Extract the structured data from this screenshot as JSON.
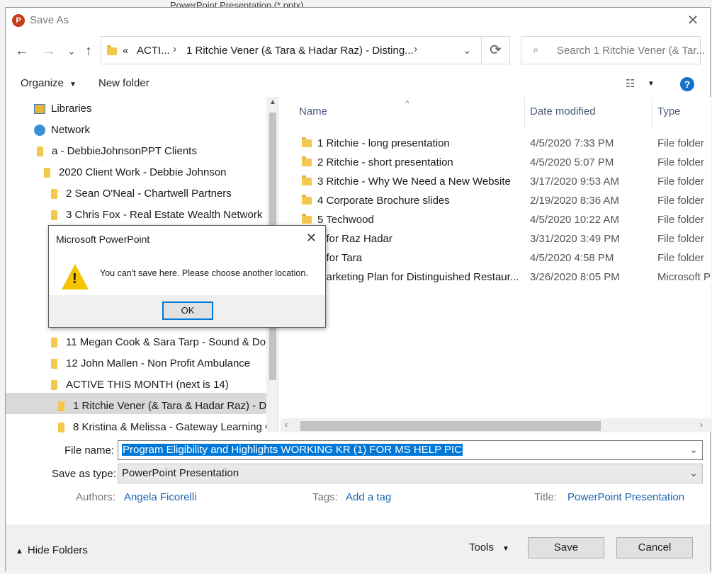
{
  "background": {
    "peek_title": "PowerPoint Presentation (*.pptx)"
  },
  "window": {
    "title": "Save As",
    "app_icon": "P",
    "close_icon": "✕"
  },
  "nav": {
    "back_icon": "←",
    "forward_icon": "→",
    "recent_icon": "⌄",
    "up_icon": "↑",
    "refresh_icon": "⟳",
    "breadcrumb": {
      "overflow": "«",
      "segments": [
        "ACTI...",
        "1 Ritchie Vener (& Tara & Hadar Raz) - Disting..."
      ],
      "separator": "›"
    },
    "dropdown_icon": "⌄",
    "search_placeholder": "Search 1 Ritchie Vener (& Tar..."
  },
  "toolbar": {
    "organize": "Organize",
    "new_folder": "New folder",
    "view_icon": "☷",
    "help": "?"
  },
  "navpane": {
    "items": [
      {
        "label": "Libraries",
        "icon": "libraries-icon",
        "indent": 0
      },
      {
        "label": "Network",
        "icon": "network-icon",
        "indent": 0
      },
      {
        "label": "a - DebbieJohnsonPPT Clients",
        "icon": "folder",
        "indent": 1
      },
      {
        "label": "2020 Client Work - Debbie Johnson",
        "icon": "folder",
        "indent": 2
      },
      {
        "label": "2 Sean O'Neal - Chartwell Partners",
        "icon": "folder",
        "indent": 3
      },
      {
        "label": "3 Chris Fox - Real Estate Wealth Network",
        "icon": "folder",
        "indent": 3
      },
      {
        "label": "11 Megan Cook & Sara Tarp - Sound & Do",
        "icon": "folder",
        "indent": 3
      },
      {
        "label": "12 John Mallen - Non Profit Ambulance",
        "icon": "folder",
        "indent": 3
      },
      {
        "label": "ACTIVE THIS MONTH (next is 14)",
        "icon": "folder",
        "indent": 3
      },
      {
        "label": "1 Ritchie Vener (& Tara & Hadar Raz) - Di",
        "icon": "folder",
        "indent": 4
      },
      {
        "label": "8 Kristina & Melissa - Gateway Learning G",
        "icon": "folder",
        "indent": 4
      }
    ]
  },
  "files": {
    "columns": {
      "name": "Name",
      "date": "Date modified",
      "type": "Type"
    },
    "rows": [
      {
        "name": "1 Ritchie - long presentation",
        "date": "4/5/2020 7:33 PM",
        "type": "File folder"
      },
      {
        "name": "2 Ritchie - short presentation",
        "date": "4/5/2020 5:07 PM",
        "type": "File folder"
      },
      {
        "name": "3 Ritchie - Why We Need a New Website",
        "date": "3/17/2020 9:53 AM",
        "type": "File folder"
      },
      {
        "name": "4 Corporate Brochure slides",
        "date": "2/19/2020 8:36 AM",
        "type": "File folder"
      },
      {
        "name": "5 Techwood",
        "date": "4/5/2020 10:22 AM",
        "type": "File folder"
      },
      {
        "name": "6 for Raz Hadar",
        "date": "3/31/2020 3:49 PM",
        "type": "File folder"
      },
      {
        "name": "7 for Tara",
        "date": "4/5/2020 4:58 PM",
        "type": "File folder"
      },
      {
        "name": "Marketing Plan for Distinguished Restaur...",
        "date": "3/26/2020 8:05 PM",
        "type": "Microsoft P"
      }
    ]
  },
  "form": {
    "file_name_label": "File name:",
    "file_name_value": "Program Eligibility and Highlights WORKING KR (1)  FOR MS HELP PIC",
    "save_type_label": "Save as type:",
    "save_type_value": "PowerPoint Presentation",
    "authors_label": "Authors:",
    "authors_value": "Angela Ficorelli",
    "tags_label": "Tags:",
    "tags_value": "Add a tag",
    "title_label": "Title:",
    "title_value": "PowerPoint Presentation"
  },
  "footer": {
    "hide_folders": "Hide Folders",
    "tools": "Tools",
    "save": "Save",
    "cancel": "Cancel"
  },
  "message_box": {
    "title": "Microsoft PowerPoint",
    "message": "You can't save here. Please choose another location.",
    "ok": "OK",
    "close_icon": "✕"
  }
}
